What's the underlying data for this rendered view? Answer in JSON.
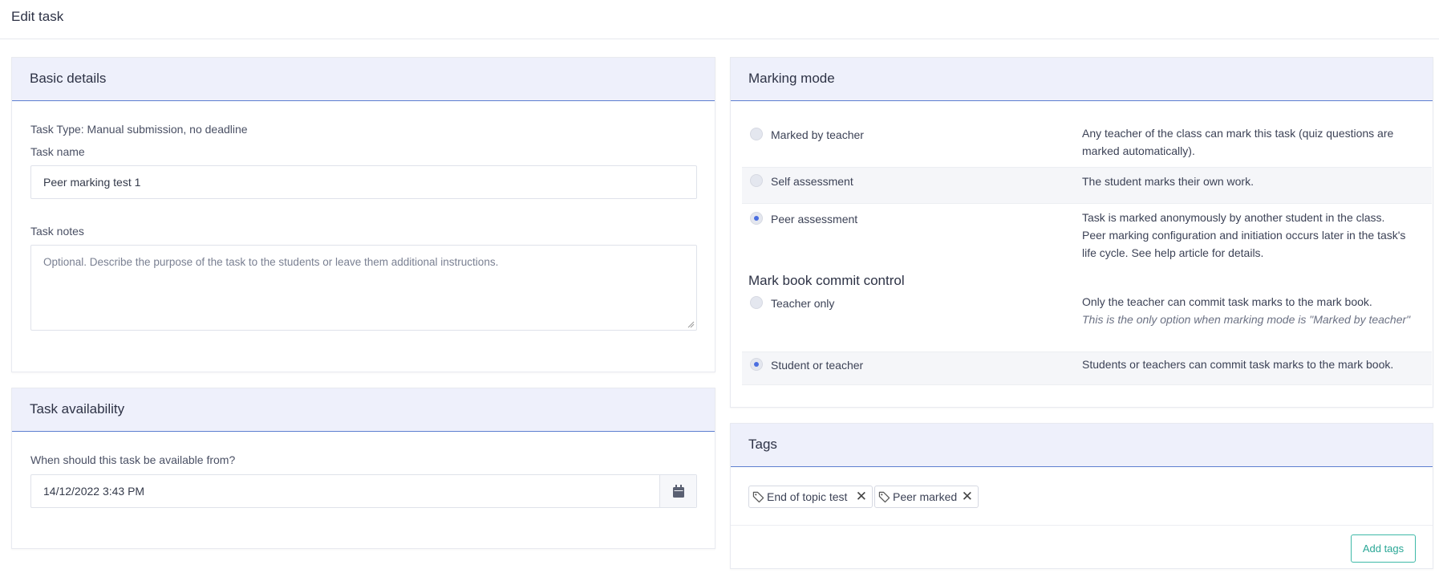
{
  "page": {
    "title": "Edit task"
  },
  "basic_details": {
    "header": "Basic details",
    "task_type": "Task Type: Manual submission, no deadline",
    "task_name_label": "Task name",
    "task_name_value": "Peer marking test 1",
    "task_notes_label": "Task notes",
    "task_notes_placeholder": "Optional. Describe the purpose of the task to the students or leave them additional instructions."
  },
  "availability": {
    "header": "Task availability",
    "question": "When should this task be available from?",
    "date_value": "14/12/2022 3:43 PM",
    "calendar_icon": "calendar-icon"
  },
  "marking_mode": {
    "header": "Marking mode",
    "options": [
      {
        "label": "Marked by teacher",
        "desc": "Any teacher of the class can mark this task (quiz questions are marked automatically).",
        "selected": false
      },
      {
        "label": "Self assessment",
        "desc": "The student marks their own work.",
        "selected": false
      },
      {
        "label": "Peer assessment",
        "desc": "Task is marked anonymously by another student in the class. Peer marking configuration and initiation occurs later in the task's life cycle. See help article for details.",
        "selected": true
      }
    ],
    "commit_header": "Mark book commit control",
    "commit_options": [
      {
        "label": "Teacher only",
        "desc": "Only the teacher can commit task marks to the mark book.",
        "note": "This is the only option when marking mode is \"Marked by teacher\"",
        "selected": false
      },
      {
        "label": "Student or teacher",
        "desc": "Students or teachers can commit task marks to the mark book.",
        "selected": true
      }
    ]
  },
  "tags": {
    "header": "Tags",
    "items": [
      {
        "label": "End of topic test",
        "remove": "✕"
      },
      {
        "label": "Peer marked",
        "remove": "✕"
      }
    ],
    "add_button": "Add tags"
  },
  "colors": {
    "header_bg": "#eef0fb",
    "header_border": "#5e7fd0",
    "accent": "#4a6ee0",
    "teal": "#2aa796"
  }
}
